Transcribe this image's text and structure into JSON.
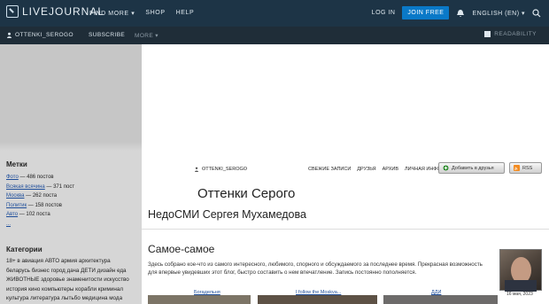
{
  "topbar": {
    "logo_text": "LIVEJOURNAL",
    "nav": [
      "FIND MORE ▾",
      "SHOP",
      "HELP"
    ],
    "login": "LOG IN",
    "join": "JOIN FREE",
    "language": "ENGLISH (EN) ▾",
    "icons": [
      "bell-icon",
      "search-icon"
    ]
  },
  "subbar": {
    "username": "OTTENKI_SEROGO",
    "subscribe": "SUBSCRIBE",
    "more": "MORE ▾",
    "readability": "READABILITY"
  },
  "sidebar": {
    "stats_title": "Метки",
    "stats": [
      {
        "link": "Фото",
        "text": " — 486 постов"
      },
      {
        "link": "Всякая всячина",
        "text": " — 371 пост"
      },
      {
        "link": "Москва",
        "text": " — 262 поста"
      },
      {
        "link": "Политик",
        "text": " — 158 постов"
      },
      {
        "link": "Авто",
        "text": " — 102 поста"
      },
      {
        "link": "...",
        "text": ""
      }
    ],
    "categories_title": "Категории",
    "categories_text": [
      "18+ в авиация АВТО армия архитектура",
      "беларусь бизнес город дача ДЕТИ дизайн еда",
      "ЖИВОТНЫЕ здоровье знаменитости искусство",
      "история кино компьютеры корабли криминал",
      "культура литература лытьбо медицина мода"
    ]
  },
  "header": {
    "username": "OTTENKI_SEROGO",
    "links": [
      "СВЕЖИЕ ЗАПИСИ",
      "ДРУЗЬЯ",
      "АРХИВ",
      "ЛИЧНАЯ ИНФОРМАЦИЯ"
    ],
    "add_friend": "Добавить в друзья",
    "rss": "RSS",
    "title": "Оттенки Серого",
    "subtitle": "НедоСМИ Сергея Мухамедова"
  },
  "content": {
    "section_title": "Самое-самое",
    "description_1": "Здесь собрано кое-что из самого интересного, любимого, спорного и обсуждаемого за последнее время. Прекрасная возможность",
    "description_2": "для впервые увидевших этот блог, быстро составить о нем впечатление. Запись постоянно пополняется.",
    "side_date": "16 мая, 2023",
    "thumb_labels": [
      "Богадельня",
      "I follow the Moskva...",
      "ДДИ"
    ]
  }
}
